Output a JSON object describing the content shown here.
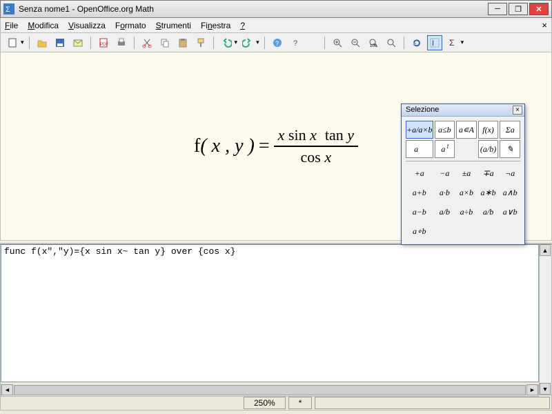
{
  "window": {
    "title": "Senza nome1 - OpenOffice.org Math"
  },
  "menubar": {
    "items": [
      {
        "label": "File",
        "u": 0
      },
      {
        "label": "Modifica",
        "u": 0
      },
      {
        "label": "Visualizza",
        "u": 0
      },
      {
        "label": "Formato",
        "u": 0
      },
      {
        "label": "Strumenti",
        "u": 0
      },
      {
        "label": "Finestra",
        "u": 2
      },
      {
        "label": "?",
        "u": 0
      }
    ],
    "close_x": "×"
  },
  "toolbar1": {
    "icons": [
      "new",
      "open",
      "save",
      "mail",
      "sep",
      "pdf",
      "print",
      "sep",
      "cut",
      "copy",
      "paste",
      "paint",
      "sep",
      "undo",
      "redo",
      "sep",
      "help-web",
      "help"
    ]
  },
  "toolbar2": {
    "icons": [
      "zoom-in",
      "zoom-out",
      "zoom-100",
      "zoom-fit",
      "sep",
      "refresh",
      "cursor",
      "sigma"
    ]
  },
  "formula": {
    "lhs_func": "f",
    "lhs_args": "( x , y )",
    "eq": "=",
    "num_a_var": "x",
    "num_a_fn": " sin ",
    "num_a_var2": "x",
    "num_b_fn": "tan ",
    "num_b_var": "y",
    "den_fn": "cos ",
    "den_var": "x"
  },
  "code": {
    "text": "func f(x\",\"y)={x sin x~ tan y} over {cos x}"
  },
  "statusbar": {
    "zoom": "250%",
    "mod": "*"
  },
  "selection_panel": {
    "title": "Selezione",
    "close": "×",
    "cat_row": [
      "+a/a×b",
      "a≤b",
      "a∊A",
      "f(x)",
      "Σa"
    ],
    "cat_row2": [
      "a⃗",
      "aꜝ",
      "",
      "(a/b)",
      "✎"
    ],
    "ops": [
      "+a",
      "−a",
      "±a",
      "∓a",
      "¬a",
      "a+b",
      "a·b",
      "a×b",
      "a∗b",
      "a∧b",
      "a−b",
      "a/b",
      "a÷b",
      "a/b",
      "a∨b",
      "a∘b",
      "",
      "",
      "",
      ""
    ]
  }
}
